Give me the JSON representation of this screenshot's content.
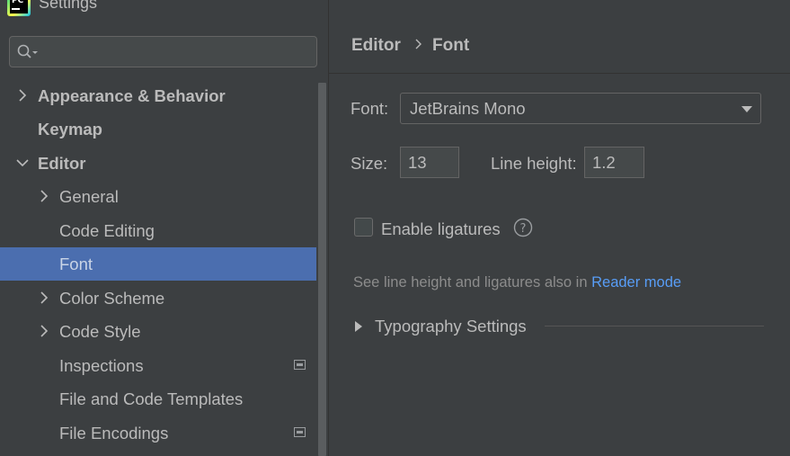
{
  "window": {
    "title": "Settings",
    "app_logo_text": "PC"
  },
  "search": {
    "placeholder": "",
    "value": ""
  },
  "tree": [
    {
      "label": "Appearance & Behavior",
      "expandable": true,
      "expanded": false
    },
    {
      "label": "Keymap",
      "expandable": false
    },
    {
      "label": "Editor",
      "expandable": true,
      "expanded": true
    },
    {
      "label": "General",
      "expandable": true,
      "expanded": false
    },
    {
      "label": "Code Editing",
      "expandable": false
    },
    {
      "label": "Font",
      "expandable": false,
      "selected": true
    },
    {
      "label": "Color Scheme",
      "expandable": true,
      "expanded": false
    },
    {
      "label": "Code Style",
      "expandable": true,
      "expanded": false
    },
    {
      "label": "Inspections",
      "expandable": false,
      "badge_icon": "project-settings-icon"
    },
    {
      "label": "File and Code Templates",
      "expandable": false
    },
    {
      "label": "File Encodings",
      "expandable": false,
      "badge_icon": "project-settings-icon"
    }
  ],
  "breadcrumb": {
    "parent": "Editor",
    "current": "Font",
    "separator_icon": "chevron-right-icon"
  },
  "font": {
    "label": "Font:",
    "value": "JetBrains Mono",
    "size_label": "Size:",
    "size_value": "13",
    "line_height_label": "Line height:",
    "line_height_value": "1.2",
    "ligatures_label": "Enable ligatures",
    "ligatures_checked": false,
    "hint_text": "See line height and ligatures also in ",
    "hint_link": "Reader mode",
    "typography_label": "Typography Settings"
  },
  "colors": {
    "background": "#3c3f41",
    "selection": "#4b6eaf",
    "text": "#bbbbbb",
    "hint": "#8c8c8c",
    "link": "#589df6"
  }
}
